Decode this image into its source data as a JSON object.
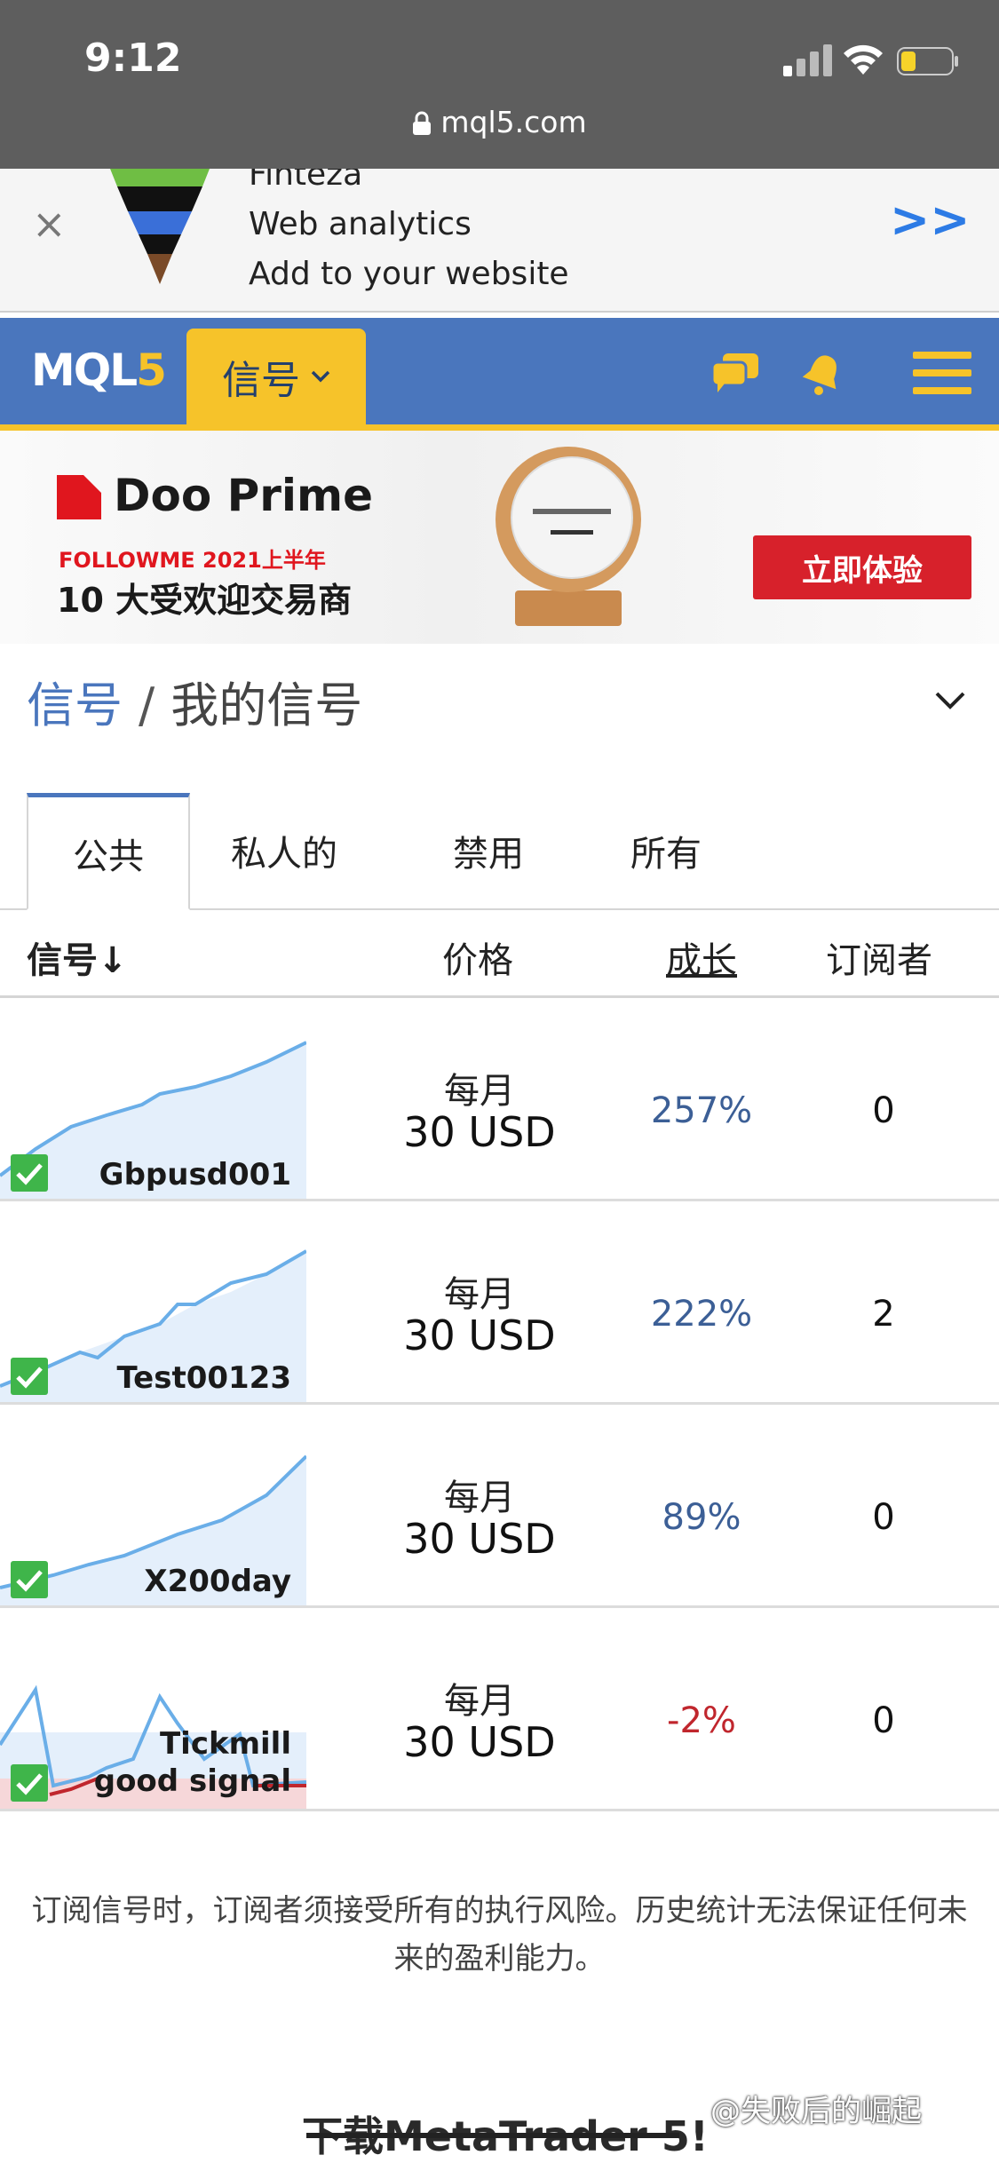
{
  "status_bar": {
    "time": "9:12",
    "url": "mql5.com"
  },
  "ad": {
    "close_symbol": "×",
    "title": "Finteza",
    "line1": "Web analytics",
    "line2": "Add to your website",
    "arrow": ">>"
  },
  "navbar": {
    "logo_main": "MQL",
    "logo_accent": "5",
    "active_tab": "信号",
    "chevron": "⌄"
  },
  "banner": {
    "brand": "Doo Prime",
    "subtitle": "FOLLOWME 2021上半年",
    "headline": "10 大受欢迎交易商",
    "cta": "立即体验",
    "colors": {
      "brand_red": "#e0161e",
      "cta_red": "#d7212b"
    }
  },
  "breadcrumb": {
    "root": "信号",
    "separator": "/",
    "current": "我的信号"
  },
  "tabs": [
    "公共",
    "私人的",
    "禁用",
    "所有"
  ],
  "table": {
    "headers": {
      "signal": "信号↓",
      "price": "价格",
      "growth": "成长",
      "subscribers": "订阅者"
    },
    "rows": [
      {
        "name": "Gbpusd001",
        "period": "每月",
        "price": "30 USD",
        "growth": "257%",
        "subscribers": "0"
      },
      {
        "name": "Test00123",
        "period": "每月",
        "price": "30 USD",
        "growth": "222%",
        "subscribers": "2"
      },
      {
        "name": "X200day",
        "period": "每月",
        "price": "30 USD",
        "growth": "89%",
        "subscribers": "0"
      },
      {
        "name": "Tickmill good signal",
        "period": "每月",
        "price": "30 USD",
        "growth": "-2%",
        "subscribers": "0"
      }
    ]
  },
  "disclaimer": "订阅信号时，订阅者须接受所有的执行风险。历史统计无法保证任何未来的盈利能力。",
  "download": "下载MetaTrader 5!",
  "watermark": "@失败后的崛起",
  "colors": {
    "nav_blue": "#4a76bd",
    "accent_yellow": "#f6c32a",
    "positive": "#3c5f96",
    "negative": "#c0262d",
    "check_green": "#3fb54a"
  }
}
